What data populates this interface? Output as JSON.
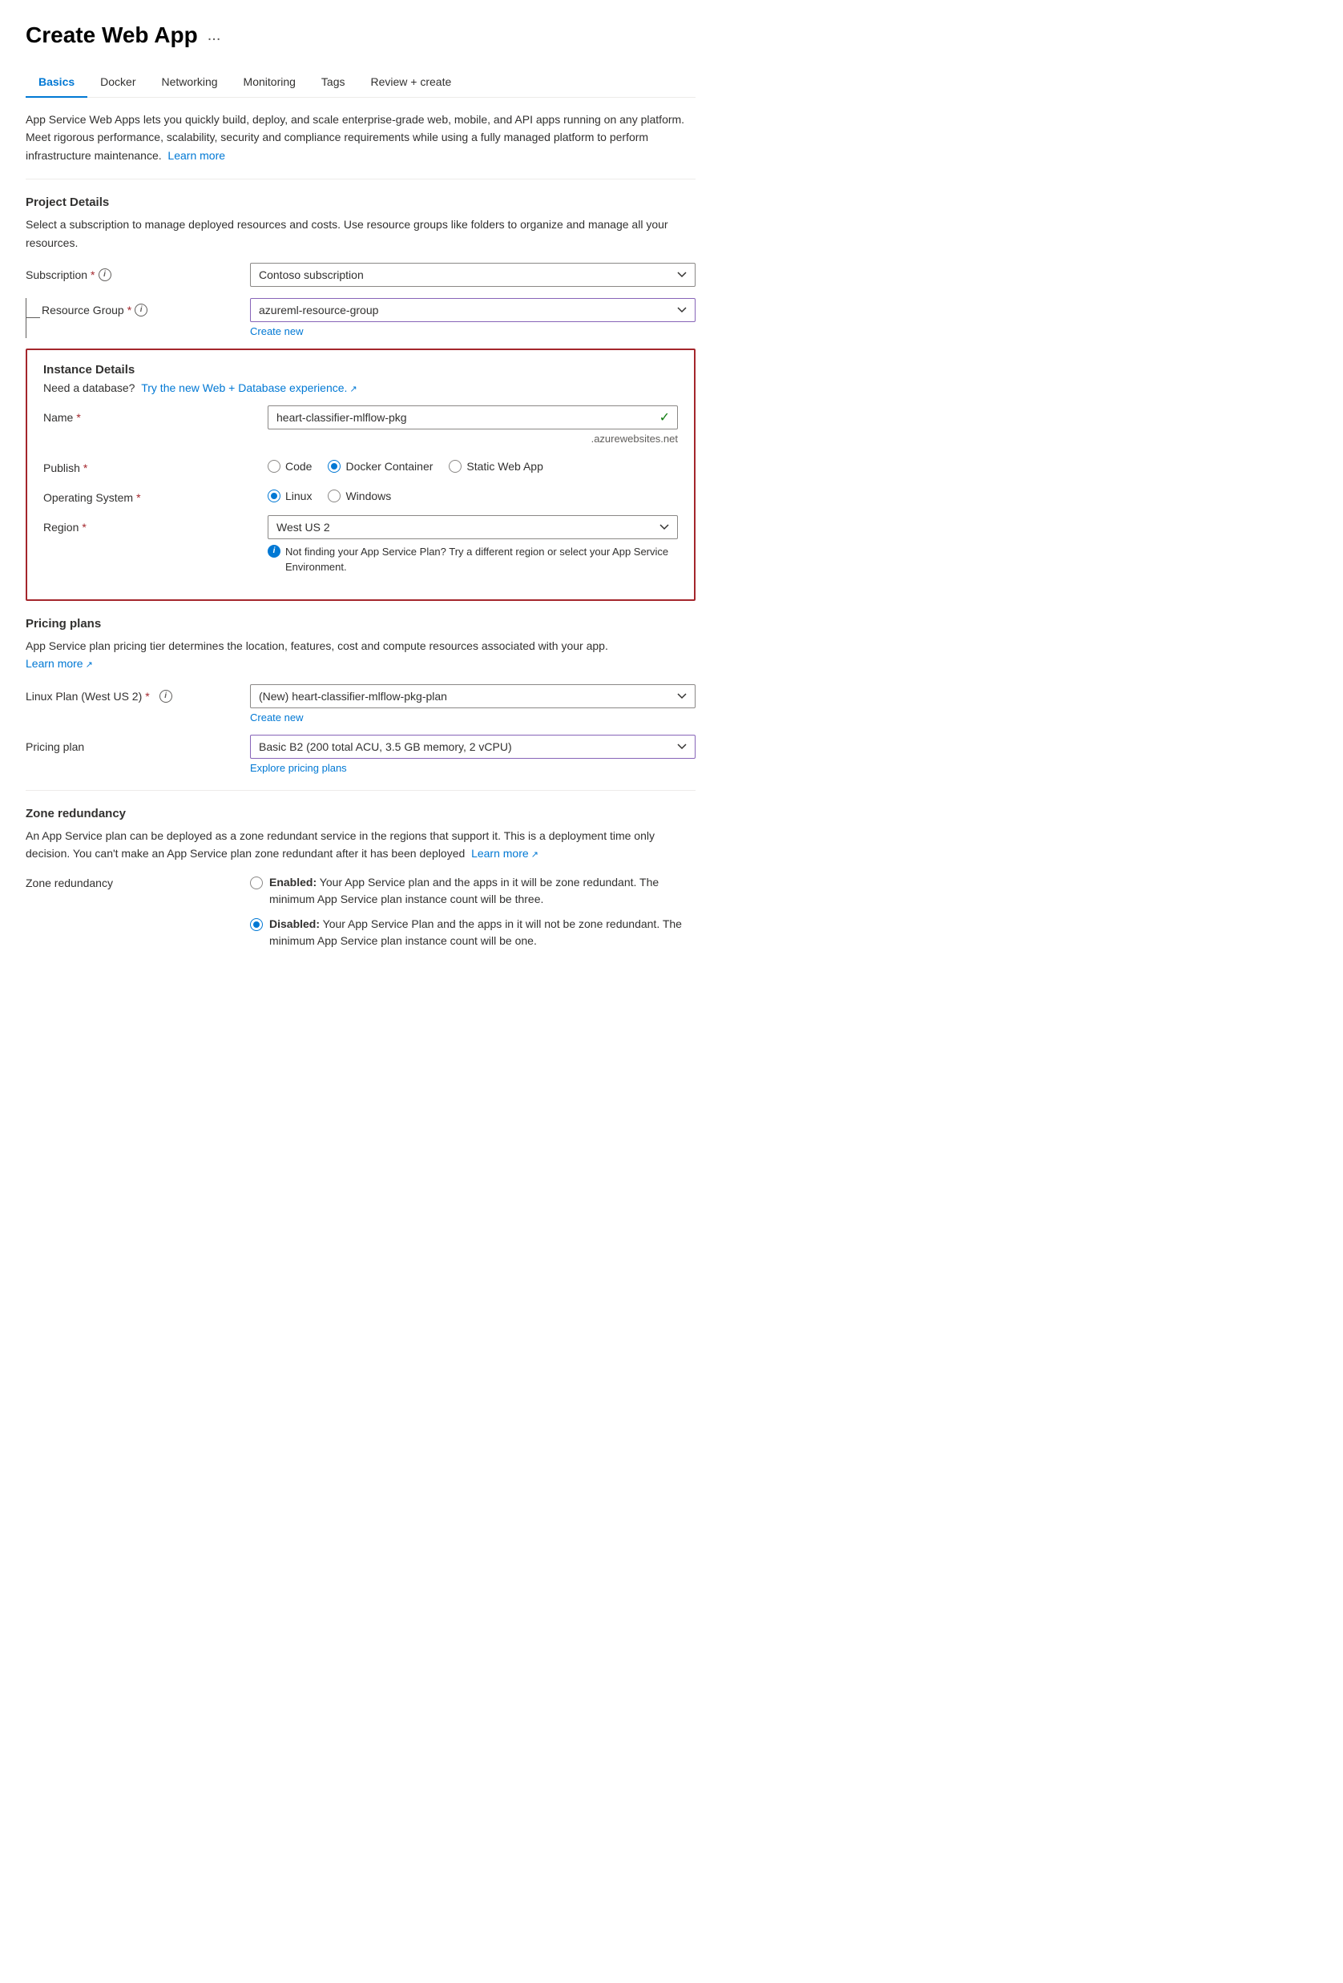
{
  "page": {
    "title": "Create Web App",
    "title_ellipsis": "..."
  },
  "tabs": [
    {
      "id": "basics",
      "label": "Basics",
      "active": true
    },
    {
      "id": "docker",
      "label": "Docker",
      "active": false
    },
    {
      "id": "networking",
      "label": "Networking",
      "active": false
    },
    {
      "id": "monitoring",
      "label": "Monitoring",
      "active": false
    },
    {
      "id": "tags",
      "label": "Tags",
      "active": false
    },
    {
      "id": "review",
      "label": "Review + create",
      "active": false
    }
  ],
  "description": "App Service Web Apps lets you quickly build, deploy, and scale enterprise-grade web, mobile, and API apps running on any platform. Meet rigorous performance, scalability, security and compliance requirements while using a fully managed platform to perform infrastructure maintenance.",
  "learn_more_1": "Learn more",
  "project_details": {
    "title": "Project Details",
    "description": "Select a subscription to manage deployed resources and costs. Use resource groups like folders to organize and manage all your resources.",
    "subscription_label": "Subscription",
    "subscription_value": "Contoso subscription",
    "resource_group_label": "Resource Group",
    "resource_group_value": "azureml-resource-group",
    "create_new": "Create new"
  },
  "instance_details": {
    "title": "Instance Details",
    "db_text": "Need a database?",
    "db_link": "Try the new Web + Database experience.",
    "name_label": "Name",
    "name_value": "heart-classifier-mlflow-pkg",
    "name_suffix": ".azurewebsites.net",
    "publish_label": "Publish",
    "publish_options": [
      {
        "id": "code",
        "label": "Code",
        "selected": false
      },
      {
        "id": "docker",
        "label": "Docker Container",
        "selected": true
      },
      {
        "id": "static",
        "label": "Static Web App",
        "selected": false
      }
    ],
    "os_label": "Operating System",
    "os_options": [
      {
        "id": "linux",
        "label": "Linux",
        "selected": true
      },
      {
        "id": "windows",
        "label": "Windows",
        "selected": false
      }
    ],
    "region_label": "Region",
    "region_value": "West US 2",
    "region_info": "Not finding your App Service Plan? Try a different region or select your App Service Environment."
  },
  "pricing_plans": {
    "title": "Pricing plans",
    "description": "App Service plan pricing tier determines the location, features, cost and compute resources associated with your app.",
    "learn_more": "Learn more",
    "linux_plan_label": "Linux Plan (West US 2)",
    "linux_plan_value": "(New) heart-classifier-mlflow-pkg-plan",
    "create_new": "Create new",
    "pricing_plan_label": "Pricing plan",
    "pricing_plan_value": "Basic B2 (200 total ACU, 3.5 GB memory, 2 vCPU)",
    "explore_link": "Explore pricing plans"
  },
  "zone_redundancy": {
    "title": "Zone redundancy",
    "description": "An App Service plan can be deployed as a zone redundant service in the regions that support it. This is a deployment time only decision. You can't make an App Service plan zone redundant after it has been deployed",
    "learn_more": "Learn more",
    "label": "Zone redundancy",
    "enabled_label": "Enabled:",
    "enabled_desc": "Your App Service plan and the apps in it will be zone redundant. The minimum App Service plan instance count will be three.",
    "disabled_label": "Disabled:",
    "disabled_desc": "Your App Service Plan and the apps in it will not be zone redundant. The minimum App Service plan instance count will be one."
  }
}
